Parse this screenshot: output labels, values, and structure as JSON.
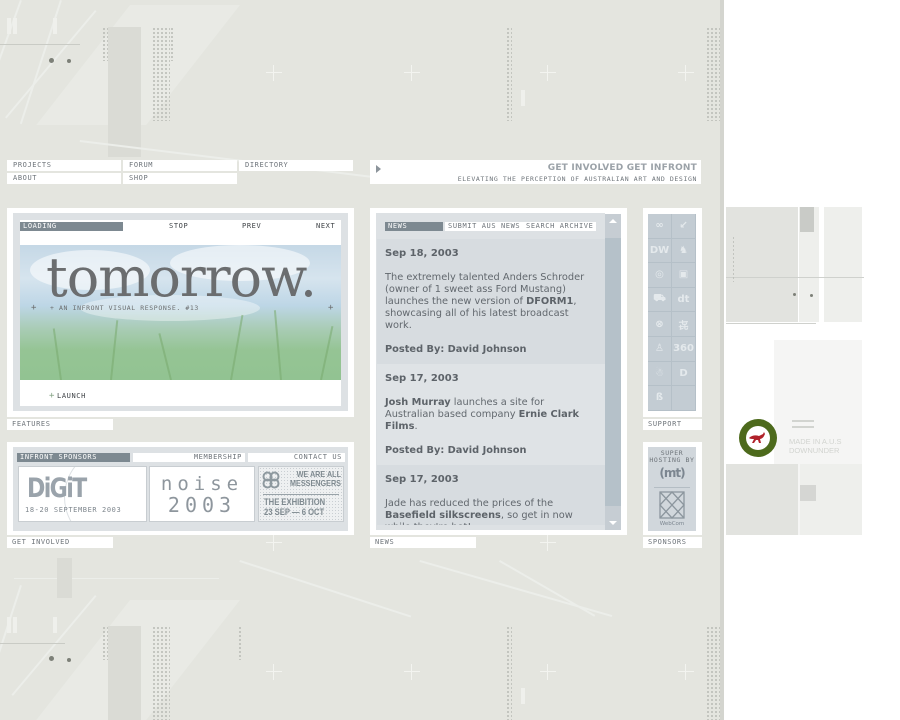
{
  "nav": {
    "items": [
      {
        "label": "Projects"
      },
      {
        "label": "Forum"
      },
      {
        "label": "Directory"
      },
      {
        "label": "About"
      },
      {
        "label": "Shop"
      }
    ]
  },
  "tagline": {
    "headline": "Get Involved Get Infront",
    "subline": "Elevating the perception of Australian art and design"
  },
  "features": {
    "loading_label": "Loading",
    "stop_label": "Stop",
    "prev_label": "Prev",
    "next_label": "Next",
    "banner_title": "tomorrow.",
    "banner_subtitle": "+ An Infront visual response. #13",
    "plus_glyph": "+",
    "launch_label": "Launch",
    "section_label": "Features"
  },
  "sponsors_panel": {
    "header": "Infront Sponsors",
    "membership_label": "Membership",
    "contact_label": "Contact Us",
    "cards": [
      {
        "logo": "DiGiT",
        "caption": "18-20 September 2003"
      },
      {
        "line1": "noise",
        "line2": "2003"
      },
      {
        "line1": "WE ARE ALL",
        "line2": "MESSENGERS",
        "line3": "THE EXHIBITION",
        "line4": "23 SEP — 6 OCT"
      }
    ],
    "section_label": "Get Involved"
  },
  "news": {
    "tabs": [
      {
        "label": "News",
        "active": true
      },
      {
        "label": "Submit Aus News",
        "active": false
      },
      {
        "label": "Search Archive",
        "active": false
      }
    ],
    "items": [
      {
        "date": "Sep 18, 2003",
        "parts": [
          {
            "text": "The extremely talented Anders Schroder (owner of 1 sweet ass Ford Mustang) launches the new version of ",
            "bold": false
          },
          {
            "text": "DFORM1",
            "bold": true
          },
          {
            "text": ", showcasing all of his latest broadcast work.",
            "bold": false
          }
        ],
        "posted_by": "Posted By: David Johnson"
      },
      {
        "date": "Sep 17, 2003",
        "parts": [
          {
            "text": "Josh Murray",
            "bold": true
          },
          {
            "text": " launches a site for Australian based company ",
            "bold": false
          },
          {
            "text": "Ernie Clark Films",
            "bold": true
          },
          {
            "text": ".",
            "bold": false
          }
        ],
        "posted_by": "Posted By: David Johnson"
      },
      {
        "date": "Sep 17, 2003",
        "parts": [
          {
            "text": "Jade has reduced the prices of the ",
            "bold": false
          },
          {
            "text": "Basefield silkscreens",
            "bold": true
          },
          {
            "text": ", so get in now while they're hot!",
            "bold": false
          }
        ],
        "posted_by": ""
      }
    ],
    "section_label": "News"
  },
  "support": {
    "icons": [
      {
        "name": "link-chain-icon",
        "glyph": "∞"
      },
      {
        "name": "corner-arrow-icon",
        "glyph": "↙"
      },
      {
        "name": "dw-logo-icon",
        "glyph": "DW"
      },
      {
        "name": "squirrel-icon",
        "glyph": "♞"
      },
      {
        "name": "fingerprint-icon",
        "glyph": "◎"
      },
      {
        "name": "photo-frame-icon",
        "glyph": "▣"
      },
      {
        "name": "truck-icon",
        "glyph": "⛟"
      },
      {
        "name": "dt-script-icon",
        "glyph": "dt"
      },
      {
        "name": "x-circle-icon",
        "glyph": "⊗"
      },
      {
        "name": "kanji-icon",
        "glyph": "㐂"
      },
      {
        "name": "figure-icon",
        "glyph": "♙"
      },
      {
        "name": "360-icon",
        "glyph": "360"
      },
      {
        "name": "bear-icon",
        "glyph": "☃"
      },
      {
        "name": "d-gothic-icon",
        "glyph": "D"
      },
      {
        "name": "lizard-icon",
        "glyph": "ß"
      },
      {
        "name": "empty-slot",
        "glyph": ""
      }
    ],
    "section_label": "Support"
  },
  "hosting": {
    "line1": "Super",
    "line2": "Hosting By",
    "mt_logo": "(mt)",
    "webcom_label": "WebCom",
    "section_label": "Sponsors"
  },
  "badge": {
    "made_in_line1": "MADE IN A.U.S",
    "made_in_line2": "DOWNUNDER",
    "roundel_outer": "#4d6a1c",
    "roundel_kangaroo": "#b0222a"
  },
  "colors": {
    "accent_bar": "#7d8991",
    "panel_bg": "#dde1e4",
    "page_bg": "#e4e5df"
  }
}
